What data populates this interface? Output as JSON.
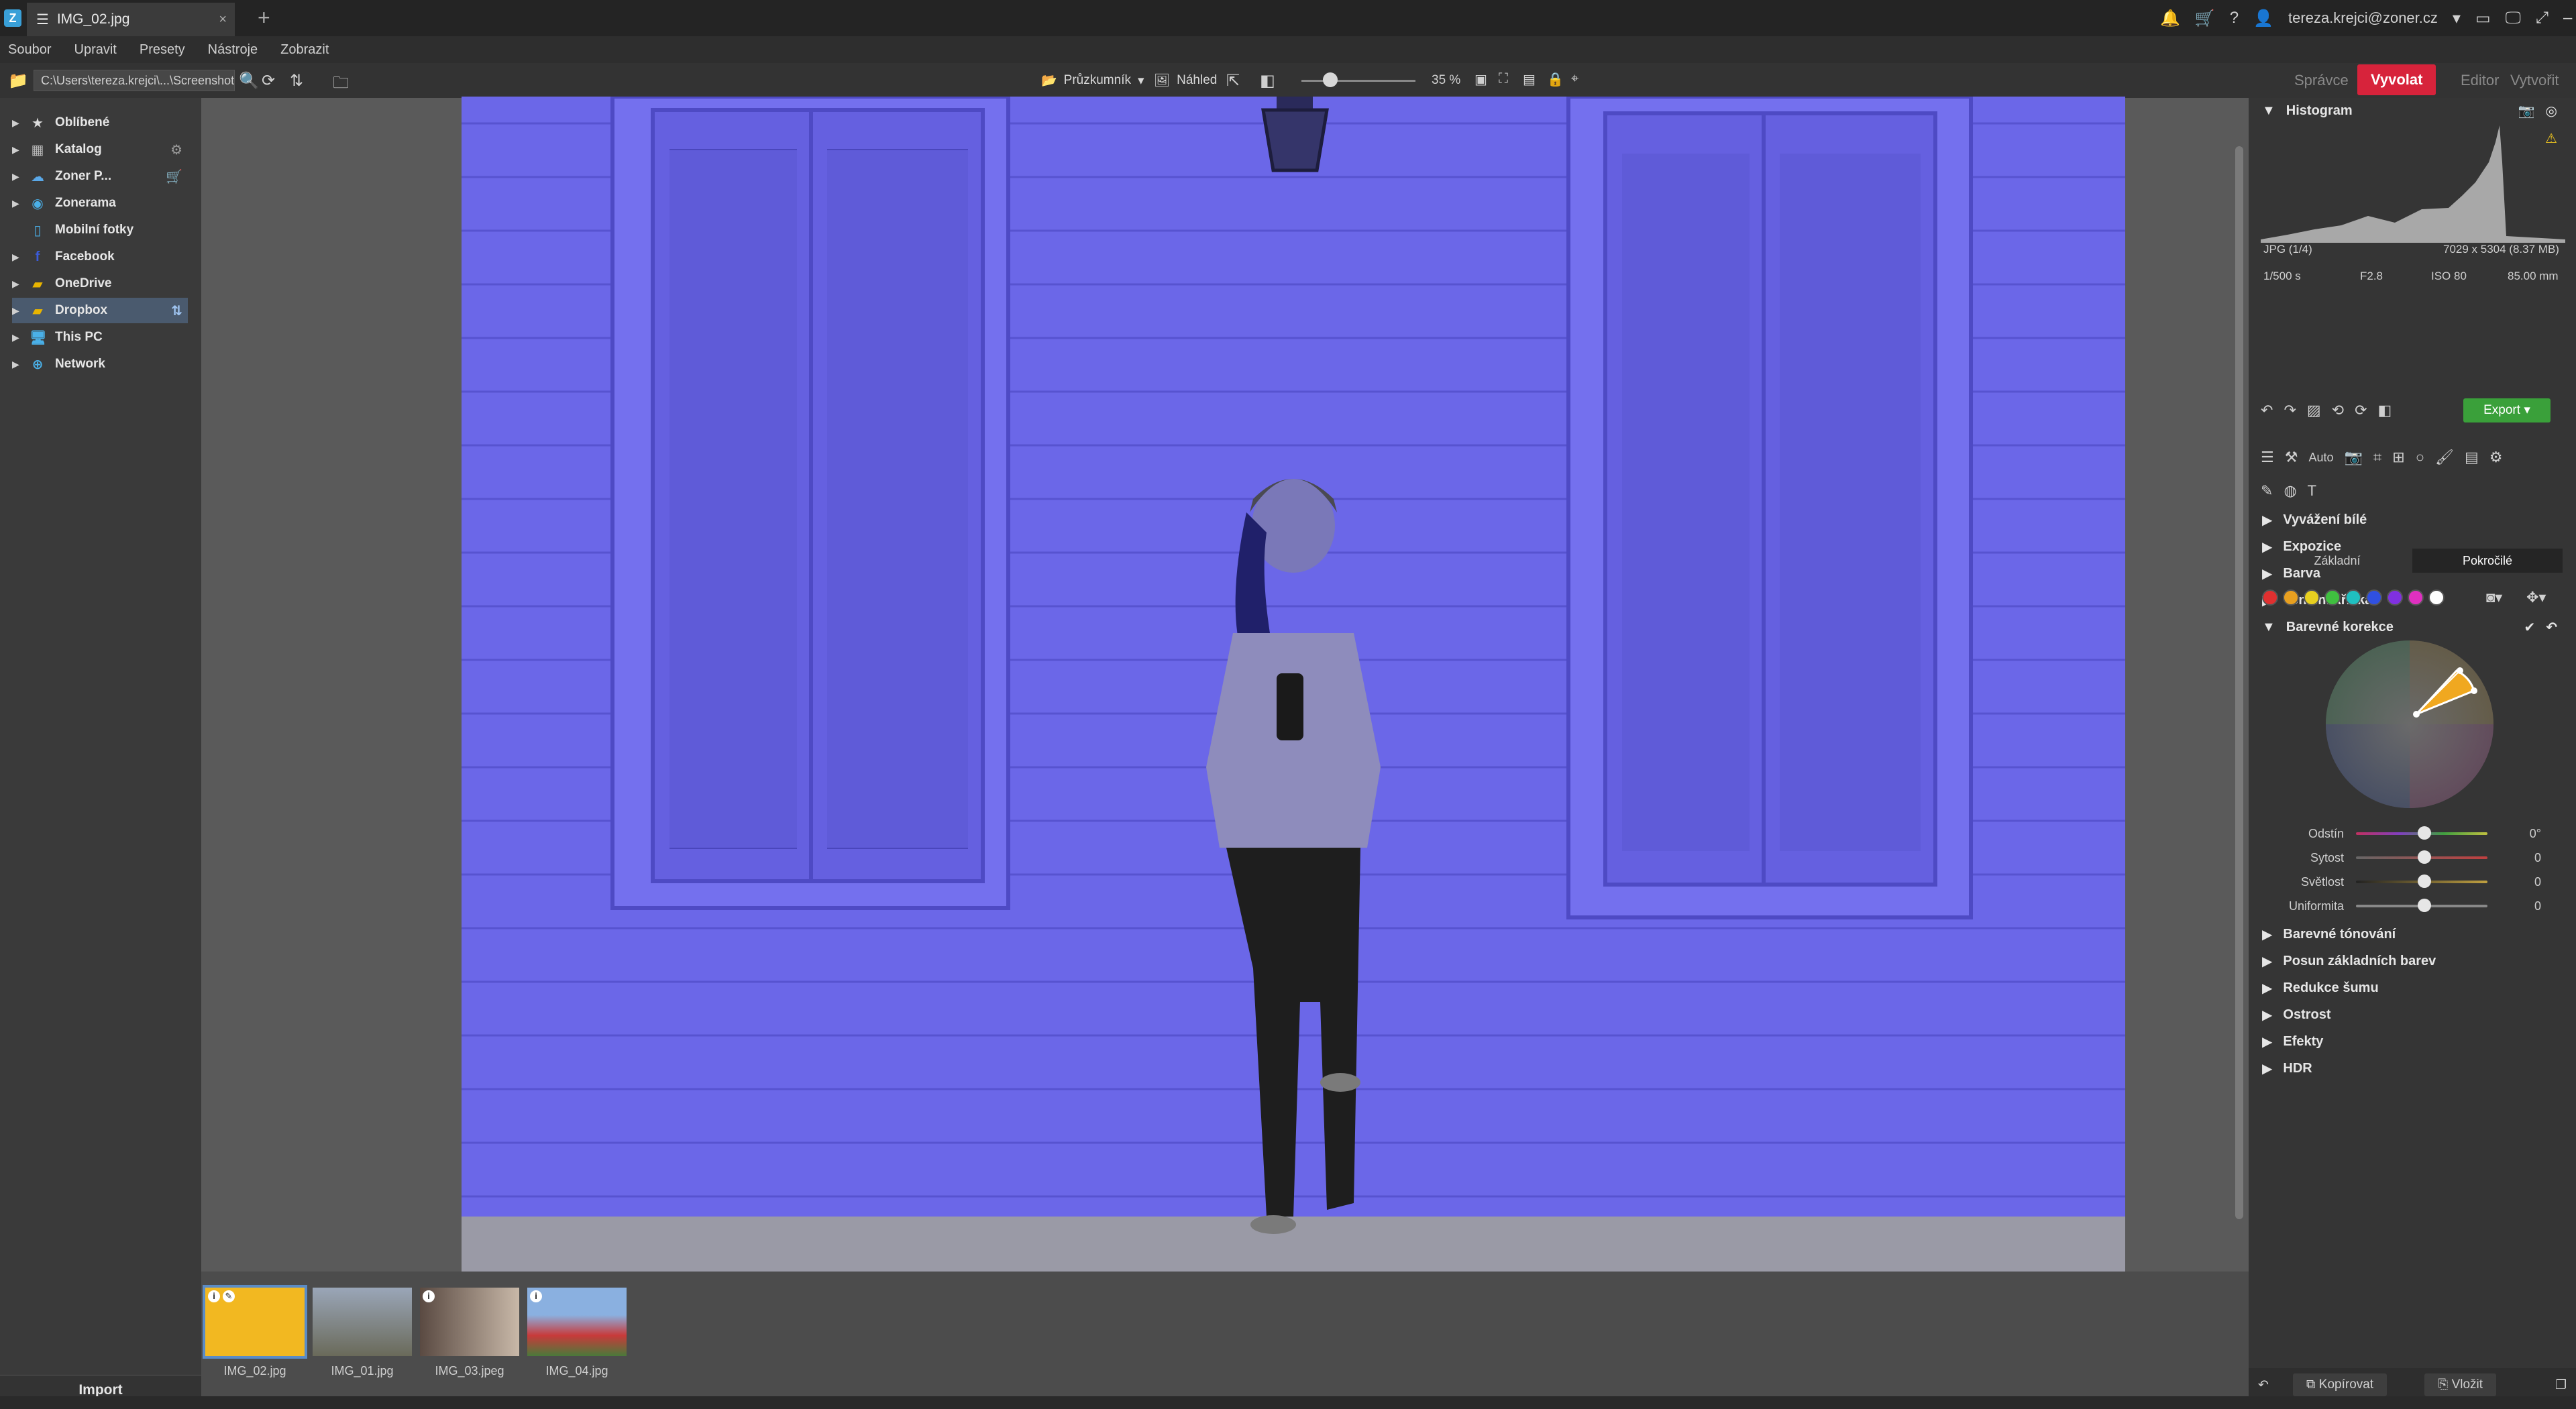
{
  "window": {
    "tab_title": "IMG_02.jpg",
    "user_email": "tereza.krejci@zoner.cz"
  },
  "menu": [
    "Soubor",
    "Upravit",
    "Presety",
    "Nástroje",
    "Zobrazit"
  ],
  "toolbar": {
    "path": "C:\\Users\\tereza.krejci\\...\\Screenshoty",
    "pruzkumnik_label": "Průzkumník",
    "nahled_label": "Náhled",
    "zoom": "35 %",
    "modes": [
      "Správce",
      "Vyvolat",
      "Editor",
      "Vytvořit"
    ]
  },
  "sidebar": {
    "items": [
      {
        "label": "Oblíbené",
        "icon": "star-icon"
      },
      {
        "label": "Katalog",
        "icon": "catalog-icon"
      },
      {
        "label": "Zoner P...",
        "icon": "cloud-icon"
      },
      {
        "label": "Zonerama",
        "icon": "zonerama-icon"
      },
      {
        "label": "Mobilní fotky",
        "icon": "phone-icon"
      },
      {
        "label": "Facebook",
        "icon": "facebook-icon"
      },
      {
        "label": "OneDrive",
        "icon": "onedrive-icon"
      },
      {
        "label": "Dropbox",
        "icon": "dropbox-icon"
      },
      {
        "label": "This PC",
        "icon": "pc-icon"
      },
      {
        "label": "Network",
        "icon": "network-icon"
      }
    ],
    "import_label": "Import"
  },
  "filmstrip": [
    {
      "name": "IMG_02.jpg"
    },
    {
      "name": "IMG_01.jpg"
    },
    {
      "name": "IMG_03.jpeg"
    },
    {
      "name": "IMG_04.jpg"
    }
  ],
  "panel": {
    "histogram_title": "Histogram",
    "file_info": "JPG  (1/4)",
    "dimensions": "7029 x 5304 (8.37 MB)",
    "shutter": "1/500 s",
    "aperture": "F2.8",
    "iso": "ISO 80",
    "focal": "85.00 mm",
    "export_label": "Export",
    "auto_label": "Auto",
    "sections_top": [
      "Vyvážení bílé",
      "Expozice",
      "Barva",
      "Tonální křivka"
    ],
    "open_section": "Barevné korekce",
    "seg_basic": "Základní",
    "seg_advanced": "Pokročilé",
    "swatch_colors": [
      "#e03030",
      "#e8a020",
      "#e8d020",
      "#40c040",
      "#20c0c0",
      "#3050e0",
      "#8030e0",
      "#e030c0",
      "#ffffff"
    ],
    "sliders": [
      {
        "label": "Odstín",
        "value": "0°"
      },
      {
        "label": "Sytost",
        "value": "0"
      },
      {
        "label": "Světlost",
        "value": "0"
      },
      {
        "label": "Uniformita",
        "value": "0"
      }
    ],
    "sections_bottom": [
      "Barevné tónování",
      "Posun základních barev",
      "Redukce šumu",
      "Ostrost",
      "Efekty",
      "HDR"
    ],
    "copy_label": "Kopírovat",
    "paste_label": "Vložit"
  },
  "colors": {
    "accent": "#d7233b",
    "photo_tint": "#6a66e6"
  }
}
